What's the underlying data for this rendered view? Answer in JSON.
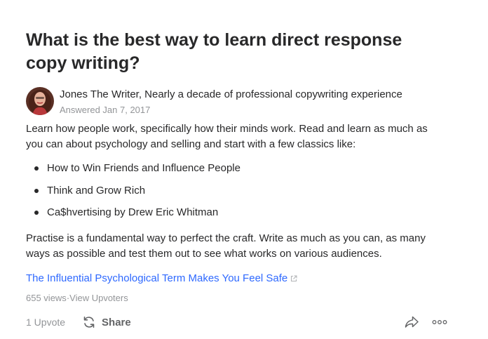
{
  "question": {
    "title": "What is the best way to learn direct response copy writing?"
  },
  "answer": {
    "author_line": "Jones The Writer, Nearly a decade of professional copywriting experience",
    "answered": "Answered Jan 7, 2017",
    "intro": "Learn how people work, specifically how their minds work. Read and learn as much as you can about psychology and selling and start with a few classics like:",
    "bullets": [
      "How to Win Friends and Influence People",
      "Think and Grow Rich",
      "Ca$hvertising by Drew Eric Whitman"
    ],
    "closing": "Practise is a fundamental way to perfect the craft. Write as much as you can, as many ways as possible and test them out to see what works on various audiences.",
    "link_text": "The Influential Psychological Term Makes You Feel Safe"
  },
  "stats": {
    "views": "655 views",
    "separator": " · ",
    "upvoters": "View Upvoters"
  },
  "actions": {
    "upvote": "1 Upvote",
    "share": "Share"
  },
  "icons": {
    "external_link": "external-link-icon",
    "share": "share-arrows-icon",
    "forward": "forward-arrow-icon",
    "more": "more-dots-icon"
  },
  "colors": {
    "text": "#282829",
    "muted": "#939598",
    "link": "#2e69ff"
  }
}
